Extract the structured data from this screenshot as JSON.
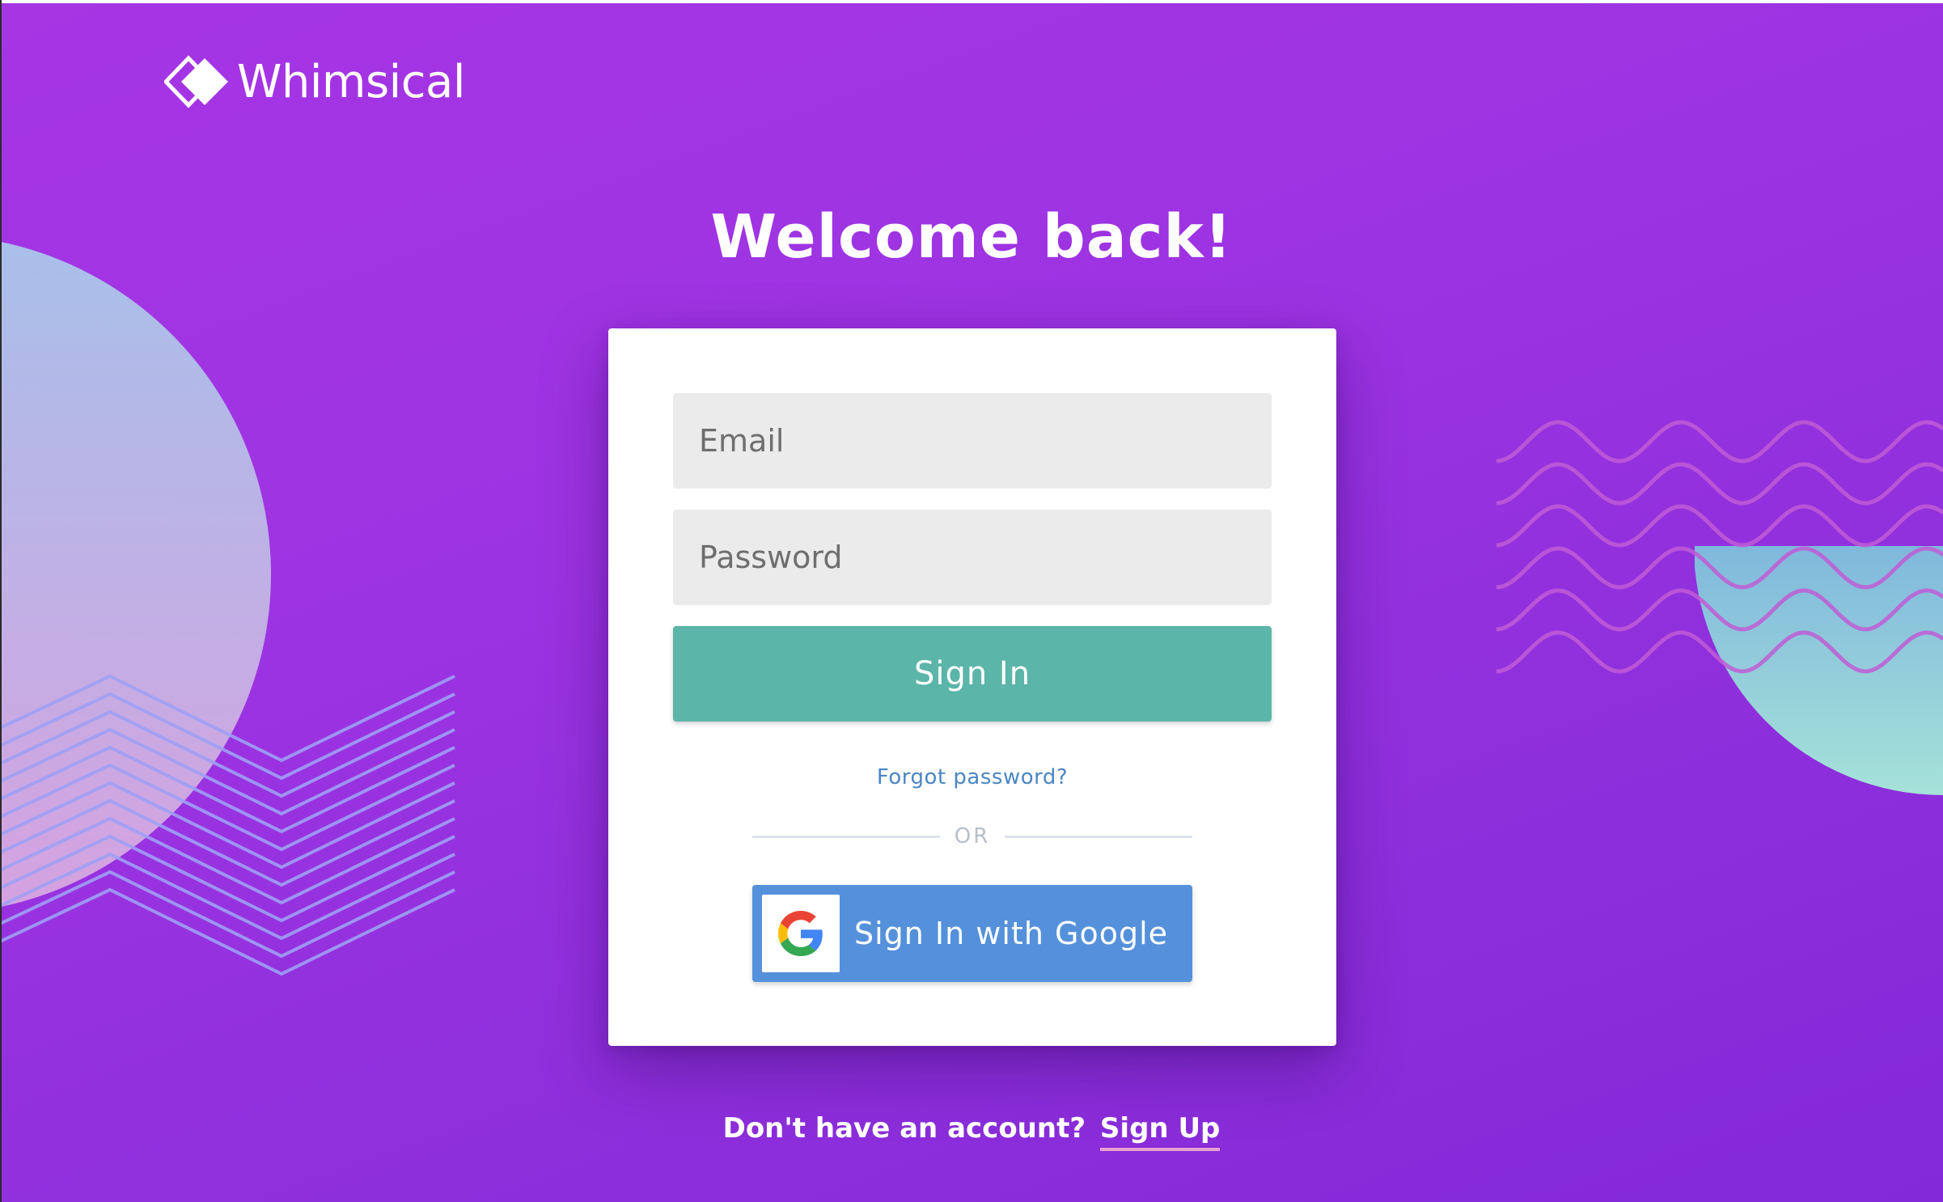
{
  "brand": {
    "name": "Whimsical",
    "accent": "#9c33e2",
    "primary_button_color": "#5cb5a9",
    "google_button_color": "#5591db",
    "link_color": "#4a86c5"
  },
  "page": {
    "heading": "Welcome back!"
  },
  "form": {
    "email_placeholder": "Email",
    "password_placeholder": "Password",
    "email_value": "",
    "password_value": "",
    "sign_in_label": "Sign In",
    "forgot_label": "Forgot password?",
    "or_label": "OR",
    "google_label": "Sign In with Google",
    "google_icon": "google-g-icon"
  },
  "footer": {
    "prompt": "Don't have an account?",
    "sign_up_label": "Sign Up"
  }
}
